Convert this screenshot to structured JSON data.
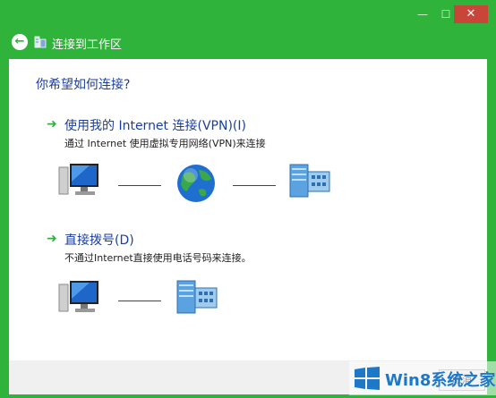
{
  "window": {
    "controls": {
      "minimize": "—",
      "maximize": "☐",
      "close": "✕"
    }
  },
  "header": {
    "back_icon": "←",
    "title": "连接到工作区"
  },
  "main": {
    "question": "你希望如何连接?",
    "options": [
      {
        "title": "使用我的 Internet 连接(VPN)(I)",
        "description": "通过 Internet 使用虚拟专用网络(VPN)来连接"
      },
      {
        "title": "直接拨号(D)",
        "description": "不通过Internet直接使用电话号码来连接。"
      }
    ]
  },
  "footer": {
    "next_label": "取消"
  },
  "watermark": {
    "text": "Win8系统之家"
  },
  "colors": {
    "accent": "#2fb33a",
    "link": "#1b3f9c",
    "close": "#c8453a"
  }
}
